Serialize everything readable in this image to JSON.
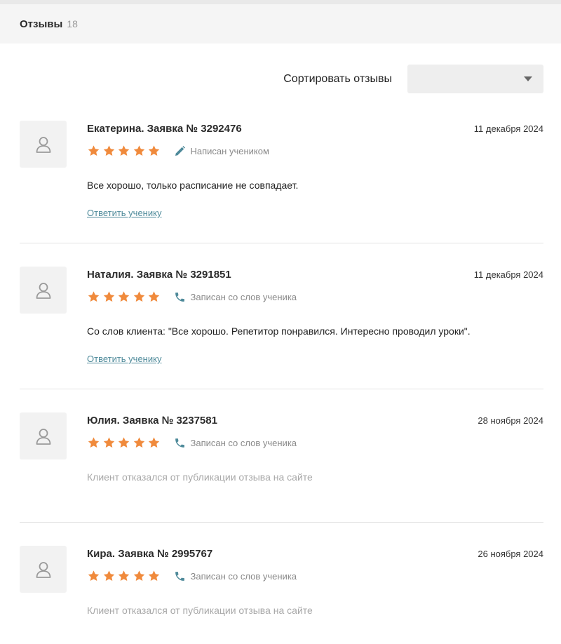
{
  "header": {
    "title": "Отзывы",
    "count": "18"
  },
  "sort": {
    "label": "Сортировать отзывы",
    "selected": ""
  },
  "colors": {
    "star": "#f08a3c",
    "accent": "#4e8a9a",
    "pen": "#4e8a9a"
  },
  "reviews": [
    {
      "name": "Екатерина. Заявка № 3292476",
      "date": "11 декабря 2024",
      "rating": 5,
      "source_icon": "pencil-icon",
      "source": "Написан учеником",
      "text": "Все хорошо, только расписание не совпадает.",
      "reply": "Ответить ученику"
    },
    {
      "name": "Наталия. Заявка № 3291851",
      "date": "11 декабря 2024",
      "rating": 5,
      "source_icon": "phone-icon",
      "source": "Записан со слов ученика",
      "text": "Со слов клиента: \"Все хорошо. Репетитор понравился. Интересно проводил уроки\".",
      "reply": "Ответить ученику"
    },
    {
      "name": "Юлия. Заявка № 3237581",
      "date": "28 ноября 2024",
      "rating": 5,
      "source_icon": "phone-icon",
      "source": "Записан со слов ученика",
      "text": "Клиент отказался от публикации отзыва на сайте"
    },
    {
      "name": "Кира. Заявка № 2995767",
      "date": "26 ноября 2024",
      "rating": 5,
      "source_icon": "phone-icon",
      "source": "Записан со слов ученика",
      "text": "Клиент отказался от публикации отзыва на сайте"
    }
  ]
}
